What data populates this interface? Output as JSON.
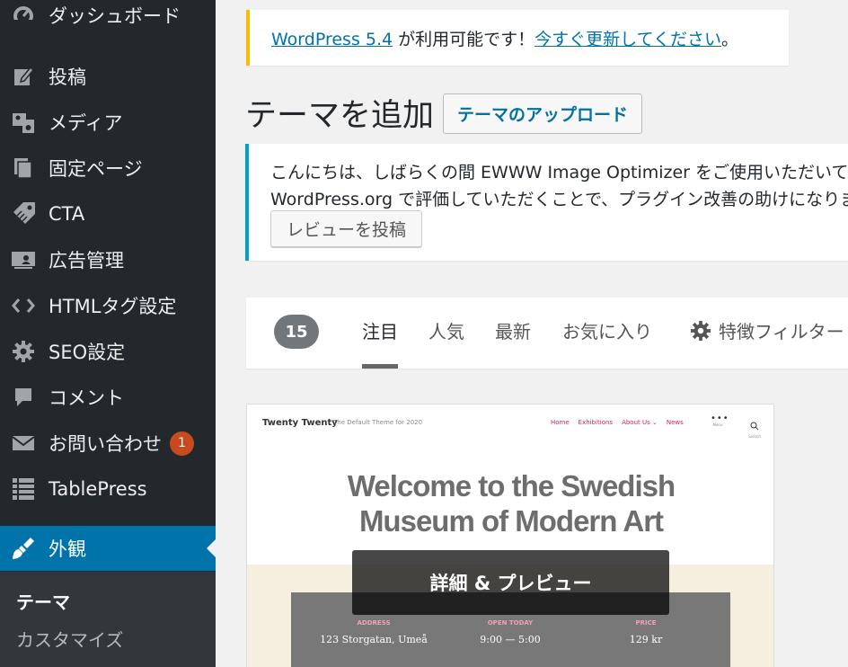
{
  "sidebar": {
    "items": [
      {
        "label": "ダッシュボード",
        "icon": "dashboard-icon"
      },
      {
        "label": "投稿",
        "icon": "post-icon"
      },
      {
        "label": "メディア",
        "icon": "media-icon"
      },
      {
        "label": "固定ページ",
        "icon": "page-icon"
      },
      {
        "label": "CTA",
        "icon": "tag-icon"
      },
      {
        "label": "広告管理",
        "icon": "ad-icon"
      },
      {
        "label": "HTMLタグ設定",
        "icon": "code-icon"
      },
      {
        "label": "SEO設定",
        "icon": "gear-icon"
      },
      {
        "label": "コメント",
        "icon": "comment-icon"
      },
      {
        "label": "お問い合わせ",
        "icon": "mail-icon",
        "badge": "1"
      },
      {
        "label": "TablePress",
        "icon": "table-icon"
      },
      {
        "label": "外観",
        "icon": "brush-icon",
        "active": true
      }
    ],
    "submenu": [
      {
        "label": "テーマ",
        "current": true
      },
      {
        "label": "カスタマイズ"
      }
    ]
  },
  "update_nag": {
    "link1": "WordPress 5.4",
    "middle": " が利用可能です！",
    "link2": "今すぐ更新してください",
    "end": "。"
  },
  "header": {
    "title": "テーマを追加",
    "upload_label": "テーマのアップロード"
  },
  "review_notice": {
    "line1": "こんにちは、しばらくの間 EWWW Image Optimizer をご使用いただいており",
    "line2": "WordPress.org で評価していただくことで、プラグイン改善の助けになります",
    "button": "レビューを投稿"
  },
  "filter": {
    "count": "15",
    "tabs": [
      "注目",
      "人気",
      "最新",
      "お気に入り"
    ],
    "current_tab": "注目",
    "feature_filter": "特徴フィルター"
  },
  "theme_card": {
    "site_title": "Twenty Twenty",
    "site_desc": "The Default Theme for 2020",
    "nav": [
      "Home",
      "Exhibitions",
      "About Us ⌄",
      "News"
    ],
    "menu_label": "Menu",
    "search_label": "Search",
    "headline_line1": "Welcome to the Swedish",
    "headline_line2": "Museum of Modern Art",
    "info": [
      {
        "key": "ADDRESS",
        "value": "123 Storgatan, Umeå"
      },
      {
        "key": "OPEN TODAY",
        "value": "9:00 — 5:00"
      },
      {
        "key": "PRICE",
        "value": "129 kr"
      }
    ],
    "preview_button": "詳細 & プレビュー"
  },
  "colors": {
    "sidebar_bg": "#23282d",
    "active_bg": "#0073aa",
    "badge": "#ca4a1f",
    "link": "#0073aa",
    "update_border": "#ffb900",
    "info_border": "#00a0d2"
  }
}
